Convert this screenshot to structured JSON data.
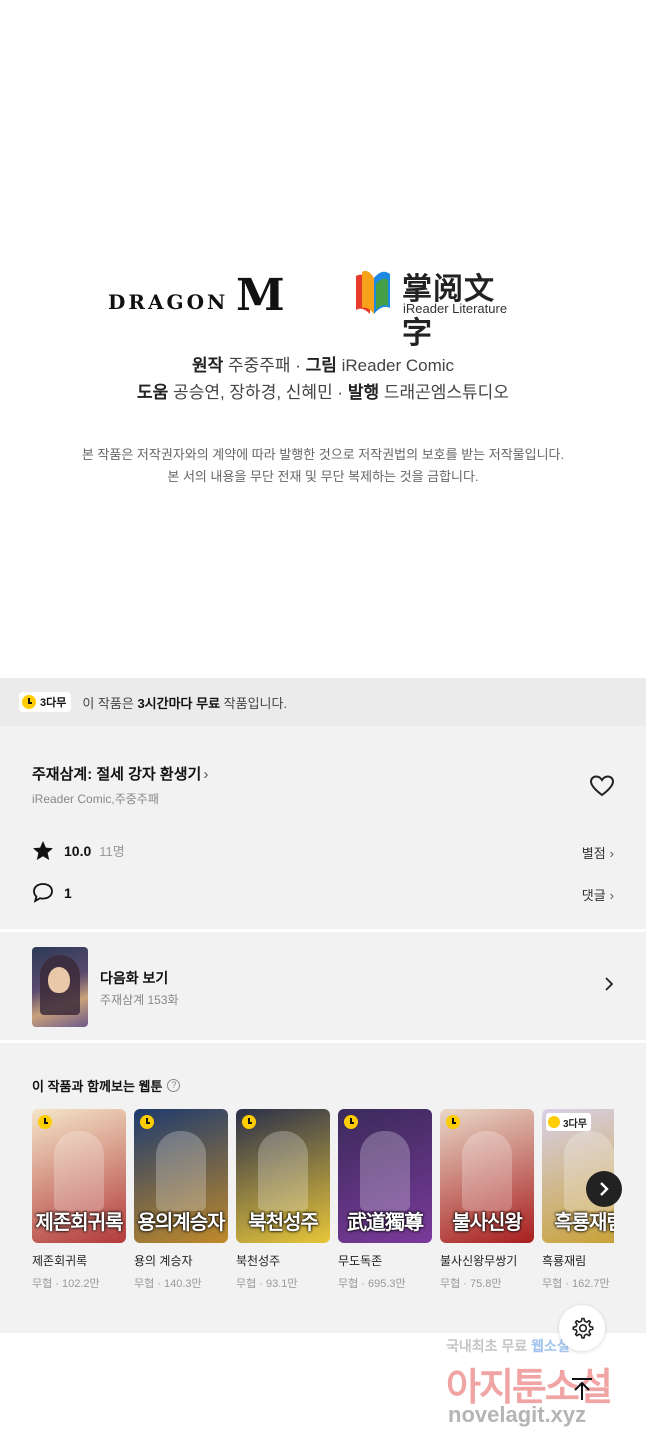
{
  "credits": {
    "logo_dragon_text": "DRAGON",
    "logo_dragon_m": "M",
    "logo_ireader_cn": "掌阅文字",
    "logo_ireader_en": "iReader Literature",
    "line1": [
      {
        "label": "원작",
        "value": " 주중주패 · "
      },
      {
        "label": "그림",
        "value": " iReader Comic"
      }
    ],
    "line2": [
      {
        "label": "도움",
        "value": " 공승연, 장하경, 신혜민 · "
      },
      {
        "label": "발행",
        "value": " 드래곤엠스튜디오"
      }
    ],
    "copyright_1": "본 작품은 저작권자와의 계약에 따라 발행한 것으로 저작권법의 보호를 받는 저작물입니다.",
    "copyright_2": "본 서의 내용을 무단 전재 및 무단 복제하는 것을 금합니다."
  },
  "free_bar": {
    "badge": "3다무",
    "text_pre": "이 작품은 ",
    "text_bold": "3시간마다 무료",
    "text_post": " 작품입니다."
  },
  "info": {
    "title": "주재삼계: 절세 강자 환생기",
    "author": "iReader Comic,주중주패",
    "rating": "10.0",
    "rating_count": "11명",
    "rating_link": "별점",
    "comment_count": "1",
    "comment_link": "댓글"
  },
  "next_episode": {
    "title": "다음화 보기",
    "subtitle": "주재삼계 153화"
  },
  "recommendations": {
    "title": "이 작품과 함께보는 웹툰",
    "help": "?",
    "items": [
      {
        "title": "제존회귀록",
        "meta": "무협 · 102.2만",
        "cover_text": "제존회귀록",
        "colors": [
          "#f4e6c8",
          "#b23a3a"
        ],
        "badge": ""
      },
      {
        "title": "용의 계승자",
        "meta": "무협 · 140.3만",
        "cover_text": "용의계승자",
        "colors": [
          "#1e3b6e",
          "#c08a2a"
        ],
        "badge": ""
      },
      {
        "title": "북천성주",
        "meta": "무협 · 93.1만",
        "cover_text": "북천성주",
        "colors": [
          "#2a2f4a",
          "#e8c63a"
        ],
        "badge": ""
      },
      {
        "title": "무도독존",
        "meta": "무협 · 695.3만",
        "cover_text": "武道獨尊",
        "colors": [
          "#3a2a5a",
          "#7a3a9a"
        ],
        "badge": ""
      },
      {
        "title": "불사신왕무쌍기",
        "meta": "무협 · 75.8만",
        "cover_text": "불사신왕",
        "colors": [
          "#e8d8c8",
          "#a81e1e"
        ],
        "badge": ""
      },
      {
        "title": "흑룡재림",
        "meta": "무협 · 162.7만",
        "cover_text": "흑룡재림",
        "colors": [
          "#d8d0e8",
          "#c8a030"
        ],
        "badge": "3다무"
      }
    ]
  },
  "watermark": {
    "line1_a": "국내최초 무료 ",
    "line1_b": "웹소설",
    "line2": "아지툰소설",
    "line3": "novelagit.xyz"
  },
  "colors": {
    "accent_yellow": "#ffcc00",
    "section_bg": "#f2f2f2",
    "free_bar_bg": "#ebebeb"
  }
}
